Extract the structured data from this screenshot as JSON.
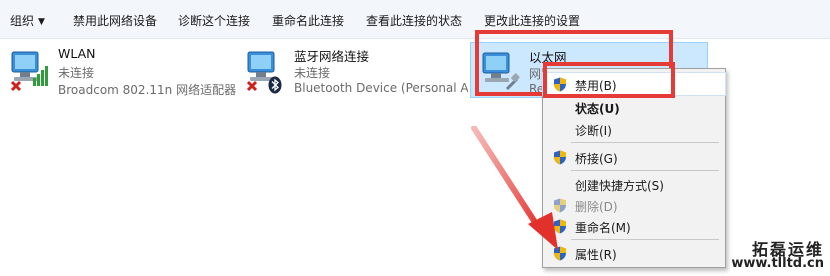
{
  "toolbar": {
    "items": [
      "组织",
      "禁用此网络设备",
      "诊断这个连接",
      "重命名此连接",
      "查看此连接的状态",
      "更改此连接的设置"
    ]
  },
  "adapters": [
    {
      "name": "WLAN",
      "status": "未连接",
      "device": "Broadcom 802.11n 网络适配器"
    },
    {
      "name": "蓝牙网络连接",
      "status": "未连接",
      "device": "Bluetooth Device (Personal Ar..."
    },
    {
      "name": "以太网",
      "status": "网",
      "device": "Re"
    }
  ],
  "context_menu": {
    "items": [
      {
        "label": "禁用(B)",
        "shield": true,
        "bold": false,
        "disabled": false
      },
      {
        "label": "状态(U)",
        "shield": false,
        "bold": true,
        "disabled": false
      },
      {
        "label": "诊断(I)",
        "shield": false,
        "bold": false,
        "disabled": false
      },
      {
        "label": "桥接(G)",
        "shield": true,
        "bold": false,
        "disabled": false
      },
      {
        "label": "创建快捷方式(S)",
        "shield": false,
        "bold": false,
        "disabled": false
      },
      {
        "label": "删除(D)",
        "shield": true,
        "bold": false,
        "disabled": true
      },
      {
        "label": "重命名(M)",
        "shield": true,
        "bold": false,
        "disabled": false
      },
      {
        "label": "属性(R)",
        "shield": true,
        "bold": false,
        "disabled": false
      }
    ]
  },
  "watermark": {
    "line1": "拓磊运维",
    "line2": "www.tlltd.cn"
  },
  "colors": {
    "highlight": "#e53a35",
    "selection_bg": "#cce8ff",
    "toolbar_bg": "#f3f6fb"
  }
}
